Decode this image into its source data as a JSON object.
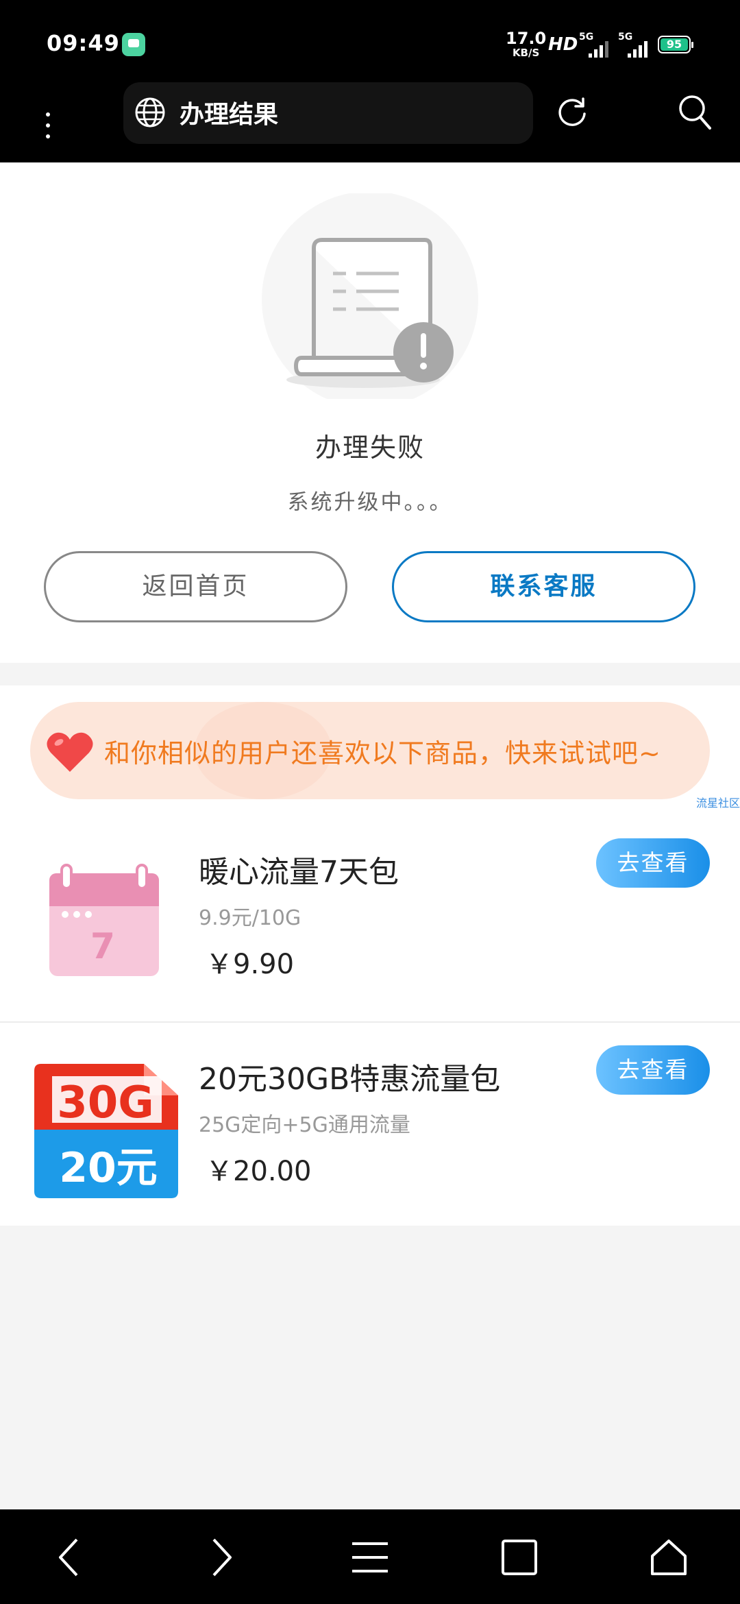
{
  "status_bar": {
    "time": "09:49",
    "net_speed_value": "17.0",
    "net_speed_unit": "KB/S",
    "hd": "HD",
    "sim1": "5G",
    "sim2": "5G",
    "battery": "95"
  },
  "browser": {
    "title": "办理结果"
  },
  "result": {
    "title": "办理失败",
    "message": "系统升级中。。。",
    "home_button": "返回首页",
    "service_button": "联系客服"
  },
  "recommend": {
    "banner_text": "和你相似的用户还喜欢以下商品，快来试试吧~",
    "tag": "流星社区",
    "items": [
      {
        "name": "暖心流量7天包",
        "desc": "9.9元/10G",
        "price": "￥9.90",
        "button": "去查看",
        "thumb_day": "7"
      },
      {
        "name": "20元30GB特惠流量包",
        "desc": "25G定向+5G通用流量",
        "price": "￥20.00",
        "button": "去查看",
        "thumb_top": "30G",
        "thumb_bottom": "20元"
      }
    ]
  },
  "colors": {
    "accent_blue": "#0a79c4",
    "banner_bg": "#fde6da",
    "banner_text": "#f07a1f",
    "battery": "#1fc18a"
  }
}
